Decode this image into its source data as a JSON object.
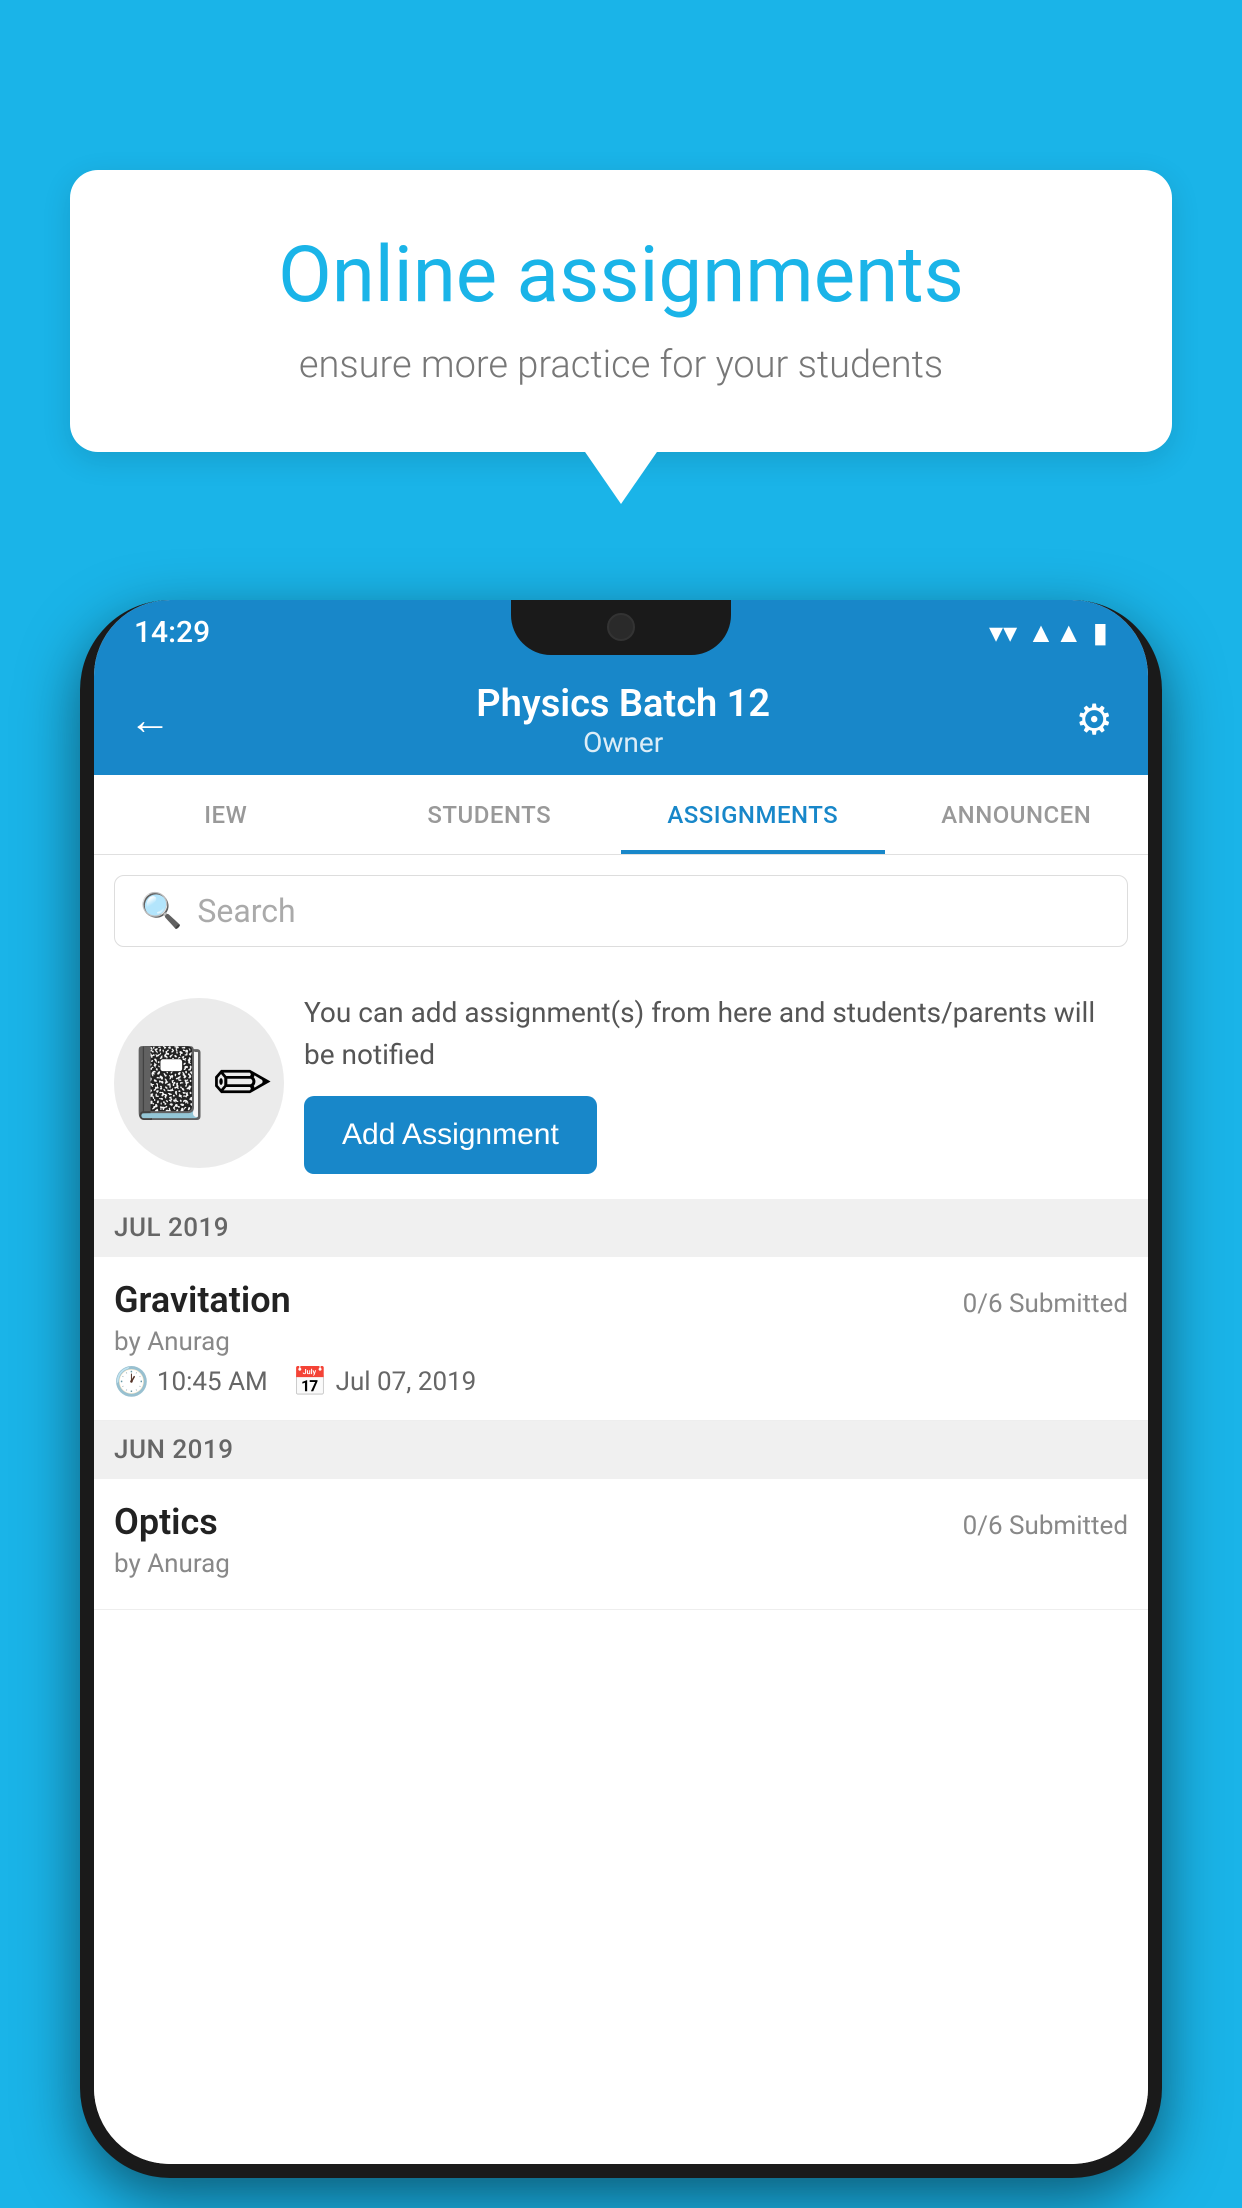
{
  "background_color": "#1ab4e8",
  "speech_bubble": {
    "heading": "Online assignments",
    "subtext": "ensure more practice for your students"
  },
  "status_bar": {
    "time": "14:29",
    "icons": [
      "wifi",
      "signal",
      "battery"
    ]
  },
  "app_header": {
    "title": "Physics Batch 12",
    "subtitle": "Owner",
    "back_label": "←",
    "settings_label": "⚙"
  },
  "tabs": [
    {
      "label": "IEW",
      "active": false
    },
    {
      "label": "STUDENTS",
      "active": false
    },
    {
      "label": "ASSIGNMENTS",
      "active": true
    },
    {
      "label": "ANNOUNCEN",
      "active": false
    }
  ],
  "search": {
    "placeholder": "Search"
  },
  "promo": {
    "text": "You can add assignment(s) from here and students/parents will be notified",
    "button_label": "Add Assignment"
  },
  "sections": [
    {
      "header": "JUL 2019",
      "items": [
        {
          "name": "Gravitation",
          "submitted": "0/6 Submitted",
          "by": "by Anurag",
          "time": "10:45 AM",
          "date": "Jul 07, 2019"
        }
      ]
    },
    {
      "header": "JUN 2019",
      "items": [
        {
          "name": "Optics",
          "submitted": "0/6 Submitted",
          "by": "by Anurag",
          "time": "",
          "date": ""
        }
      ]
    }
  ]
}
